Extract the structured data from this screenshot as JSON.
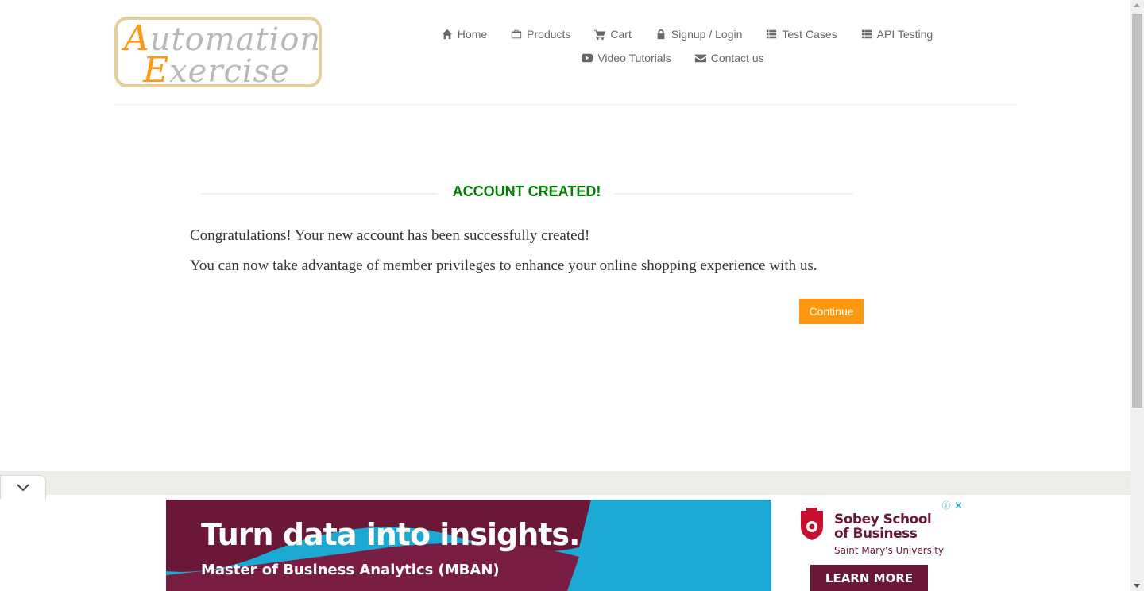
{
  "logo": {
    "line1_cap": "A",
    "line1_rest": "utomation",
    "line2_cap": "E",
    "line2_rest": "xercise"
  },
  "nav": {
    "row1": [
      {
        "label": "Home",
        "icon": "home-icon"
      },
      {
        "label": "Products",
        "icon": "briefcase-icon"
      },
      {
        "label": "Cart",
        "icon": "cart-icon"
      },
      {
        "label": "Signup / Login",
        "icon": "lock-icon"
      },
      {
        "label": "Test Cases",
        "icon": "list-icon"
      },
      {
        "label": "API Testing",
        "icon": "list-icon"
      }
    ],
    "row2": [
      {
        "label": "Video Tutorials",
        "icon": "youtube-play-icon"
      },
      {
        "label": "Contact us",
        "icon": "envelope-icon"
      }
    ]
  },
  "main": {
    "title": "ACCOUNT CREATED!",
    "message1": "Congratulations! Your new account has been successfully created!",
    "message2": "You can now take advantage of member privileges to enhance your online shopping experience with us.",
    "continue_label": "Continue"
  },
  "ad": {
    "headline": "Turn data into insights.",
    "subheadline": "Master of Business Analytics (MBAN)",
    "school": "Sobey School\nof Business",
    "school_line1": "Sobey School",
    "school_line2": "of Business",
    "university": "Saint Mary's University",
    "cta": "LEARN MORE",
    "info": "ⓘ",
    "close": "✕"
  },
  "colors": {
    "accent": "#fe980f",
    "success": "#008000",
    "ad_bg": "#1ba9d3",
    "ad_brand": "#6b1738"
  }
}
